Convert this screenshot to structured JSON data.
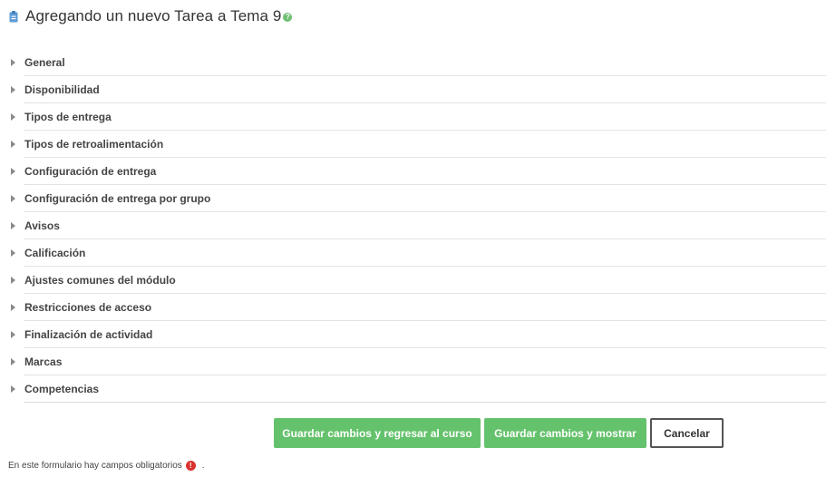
{
  "header": {
    "title": "Agregando un nuevo Tarea a Tema 9",
    "help_icon": "?",
    "assign_icon": "assignment-icon"
  },
  "sections": [
    {
      "label": "General",
      "icon": "caret-right-icon"
    },
    {
      "label": "Disponibilidad",
      "icon": "caret-right-icon"
    },
    {
      "label": "Tipos de entrega",
      "icon": "caret-right-icon"
    },
    {
      "label": "Tipos de retroalimentación",
      "icon": "caret-right-icon"
    },
    {
      "label": "Configuración de entrega",
      "icon": "caret-right-icon"
    },
    {
      "label": "Configuración de entrega por grupo",
      "icon": "caret-right-icon"
    },
    {
      "label": "Avisos",
      "icon": "caret-right-icon"
    },
    {
      "label": "Calificación",
      "icon": "caret-right-icon"
    },
    {
      "label": "Ajustes comunes del módulo",
      "icon": "caret-right-icon"
    },
    {
      "label": "Restricciones de acceso",
      "icon": "caret-right-icon"
    },
    {
      "label": "Finalización de actividad",
      "icon": "caret-right-icon"
    },
    {
      "label": "Marcas",
      "icon": "caret-right-icon"
    },
    {
      "label": "Competencias",
      "icon": "caret-right-icon"
    }
  ],
  "buttons": {
    "save_return": "Guardar cambios y regresar al curso",
    "save_show": "Guardar cambios y mostrar",
    "cancel": "Cancelar"
  },
  "footer": {
    "required_note": "En este formulario hay campos obligatorios",
    "required_icon": "!",
    "trailing": "."
  },
  "colors": {
    "primary_button": "#65c26c",
    "help_icon": "#6fbe73",
    "required_icon": "#d9322f",
    "assign_icon": "#5b9bd5"
  }
}
